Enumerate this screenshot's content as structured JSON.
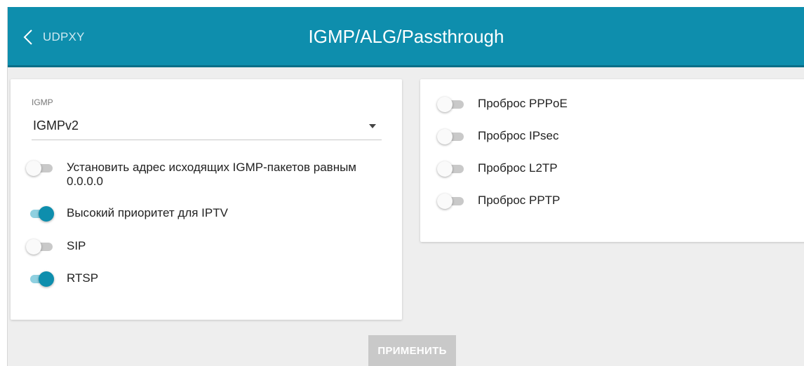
{
  "header": {
    "back_label": "UDPXY",
    "title": "IGMP/ALG/Passthrough",
    "background_color": "#0e8ead"
  },
  "igmp": {
    "label": "IGMP",
    "value": "IGMPv2"
  },
  "left_toggles": [
    {
      "label": "Установить адрес исходящих IGMP-пакетов равным 0.0.0.0",
      "on": false
    },
    {
      "label": "Высокий приоритет для IPTV",
      "on": true
    },
    {
      "label": "SIP",
      "on": false
    },
    {
      "label": "RTSP",
      "on": true
    }
  ],
  "right_toggles": [
    {
      "label": "Проброс PPPoE",
      "on": false
    },
    {
      "label": "Проброс IPsec",
      "on": false
    },
    {
      "label": "Проброс L2TP",
      "on": false
    },
    {
      "label": "Проброс PPTP",
      "on": false
    }
  ],
  "apply_label": "ПРИМЕНИТЬ",
  "icons": {
    "back": "chevron-left-icon",
    "dropdown": "caret-down-icon"
  },
  "colors": {
    "accent": "#0e8ead",
    "toggle_on_track": "#8fd0e0",
    "toggle_off_track": "#c9c9c9",
    "button_disabled": "#c9c9c9"
  }
}
